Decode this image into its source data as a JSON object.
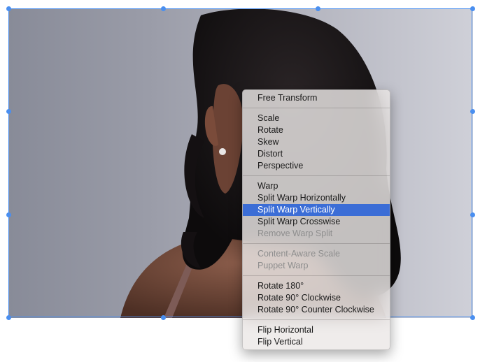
{
  "context_menu": {
    "highlight_color": "#3b6dd6",
    "groups": [
      [
        {
          "label": "Free Transform",
          "enabled": true,
          "highlighted": false
        }
      ],
      [
        {
          "label": "Scale",
          "enabled": true,
          "highlighted": false
        },
        {
          "label": "Rotate",
          "enabled": true,
          "highlighted": false
        },
        {
          "label": "Skew",
          "enabled": true,
          "highlighted": false
        },
        {
          "label": "Distort",
          "enabled": true,
          "highlighted": false
        },
        {
          "label": "Perspective",
          "enabled": true,
          "highlighted": false
        }
      ],
      [
        {
          "label": "Warp",
          "enabled": true,
          "highlighted": false
        },
        {
          "label": "Split Warp Horizontally",
          "enabled": true,
          "highlighted": false
        },
        {
          "label": "Split Warp Vertically",
          "enabled": true,
          "highlighted": true
        },
        {
          "label": "Split Warp Crosswise",
          "enabled": true,
          "highlighted": false
        },
        {
          "label": "Remove Warp Split",
          "enabled": false,
          "highlighted": false
        }
      ],
      [
        {
          "label": "Content-Aware Scale",
          "enabled": false,
          "highlighted": false
        },
        {
          "label": "Puppet Warp",
          "enabled": false,
          "highlighted": false
        }
      ],
      [
        {
          "label": "Rotate 180°",
          "enabled": true,
          "highlighted": false
        },
        {
          "label": "Rotate 90° Clockwise",
          "enabled": true,
          "highlighted": false
        },
        {
          "label": "Rotate 90° Counter Clockwise",
          "enabled": true,
          "highlighted": false
        }
      ],
      [
        {
          "label": "Flip Horizontal",
          "enabled": true,
          "highlighted": false
        },
        {
          "label": "Flip Vertical",
          "enabled": true,
          "highlighted": false
        }
      ]
    ]
  },
  "transform_box": {
    "color": "#4a8ff0"
  }
}
